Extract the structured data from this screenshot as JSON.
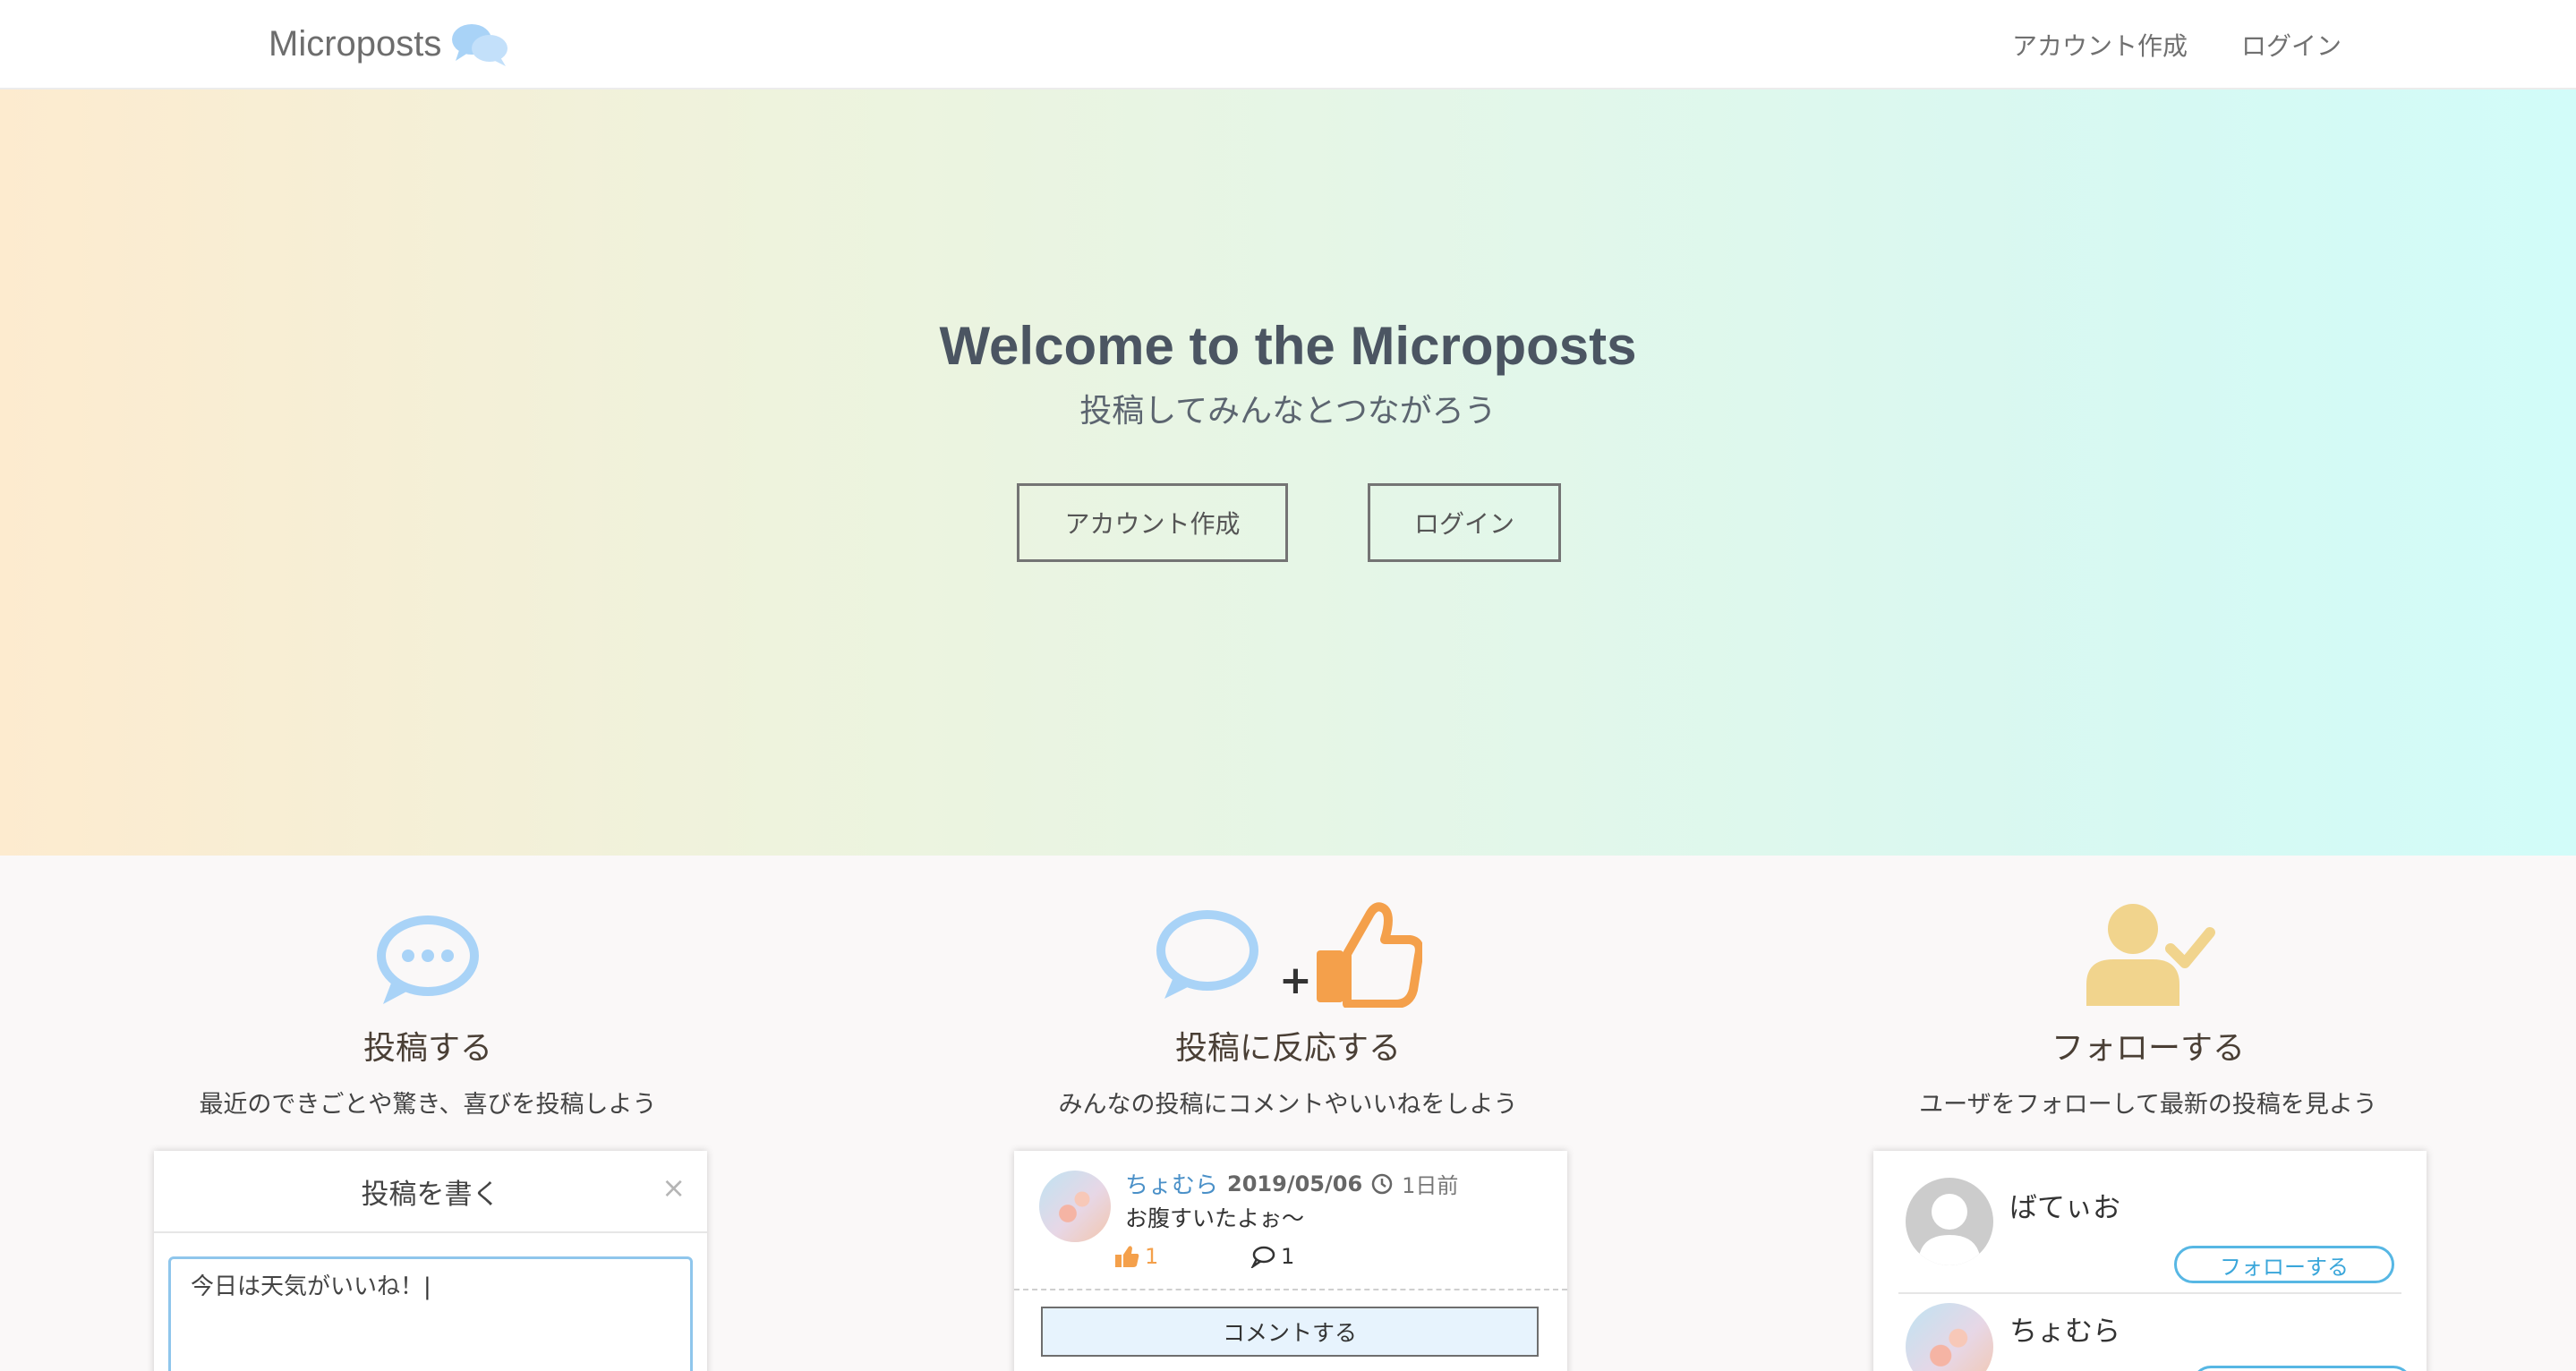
{
  "nav": {
    "brand": "Microposts",
    "links": [
      "アカウント作成",
      "ログイン"
    ]
  },
  "hero": {
    "title": "Welcome to the Microposts",
    "subtitle": "投稿してみんなとつながろう",
    "buttons": [
      "アカウント作成",
      "ログイン"
    ]
  },
  "features": [
    {
      "icon": "speech-bubble-dots-icon",
      "title": "投稿する",
      "desc": "最近のできごとや驚き、喜びを投稿しよう"
    },
    {
      "icon": "comment-plus-like-icon",
      "title": "投稿に反応する",
      "desc": "みんなの投稿にコメントやいいねをしよう"
    },
    {
      "icon": "user-check-icon",
      "title": "フォローする",
      "desc": "ユーザをフォローして最新の投稿を見よう"
    }
  ],
  "compose": {
    "title": "投稿を書く",
    "close": "×",
    "value": "今日は天気がいいね！"
  },
  "sample_post": {
    "user": "ちょむら",
    "date": "2019/05/06",
    "ago": "1日前",
    "text": "お腹すいたよぉ〜",
    "likes": "1",
    "comments": "1",
    "comment_button": "コメントする"
  },
  "follow_list": [
    {
      "name": "ばてぃお",
      "button": "フォローする"
    },
    {
      "name": "ちょむら"
    }
  ],
  "colors": {
    "icon_blue": "#a9d3f7",
    "icon_orange": "#f4a04b",
    "icon_yellow": "#f1d48d",
    "follow_blue": "#57b7e4"
  }
}
